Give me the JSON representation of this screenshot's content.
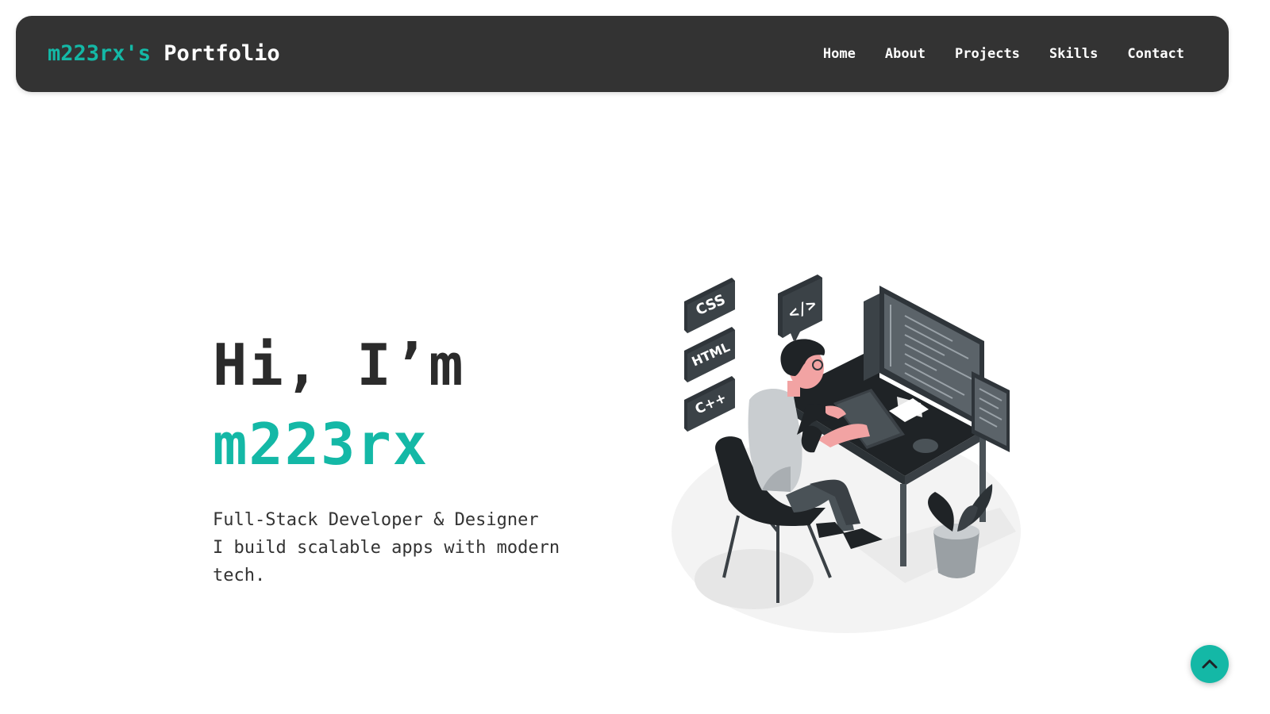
{
  "navbar": {
    "brand_accent": "m223rx's",
    "brand_rest": " Portfolio",
    "links": [
      {
        "label": "Home"
      },
      {
        "label": "About"
      },
      {
        "label": "Projects"
      },
      {
        "label": "Skills"
      },
      {
        "label": "Contact"
      }
    ]
  },
  "hero": {
    "greeting": "Hi, I’m",
    "name": "m223rx",
    "tagline_line1": "Full-Stack Developer & Designer",
    "tagline_line2": "I build scalable apps with modern tech."
  },
  "illustration": {
    "badges": [
      "CSS",
      "HTML",
      "C++"
    ],
    "code_bubble": "</>"
  },
  "colors": {
    "accent": "#14b8a6",
    "navbar_bg": "#333333",
    "text_dark": "#2b2b2b"
  },
  "icons": {
    "scroll_top": "chevron-up-icon"
  }
}
